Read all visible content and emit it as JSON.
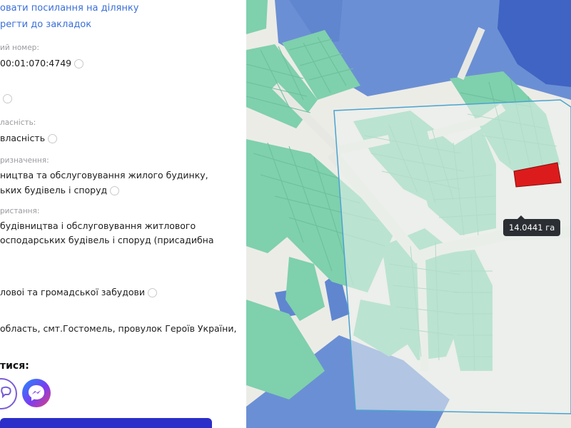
{
  "panel": {
    "link_share": "овати посилання на ділянку",
    "link_bookmark": "регти до закладок",
    "cadastral_label": "ий номер:",
    "cadastral_value": "00:01:070:4749",
    "ownership_label": "ласність:",
    "ownership_value": "власність",
    "purpose_label": "ризначення:",
    "purpose_line1": "ництва та обслуговування жилого будинку,",
    "purpose_line2": "ьких будівель і споруд",
    "usage_label": "ристання:",
    "usage_line1": "будівництва і обслуговування житлового",
    "usage_line2": "осподарських будівель і споруд (присадибна",
    "zoning_value": "ловоі та громадської забудови",
    "address_value": "область, смт.Гостомель, провулок Героїв України,",
    "share_title": "тися:"
  },
  "map": {
    "area_tooltip": "14.0441 га",
    "colors": {
      "parcel_green": "#7fd0ad",
      "parcel_blue": "#6b8fd4",
      "parcel_dark_blue": "#3f64c3",
      "selected_parcel": "#dc1c1c",
      "selection_box": "#4aa3cf"
    }
  },
  "icons": [
    "info-icon",
    "viber-icon",
    "messenger-icon"
  ]
}
